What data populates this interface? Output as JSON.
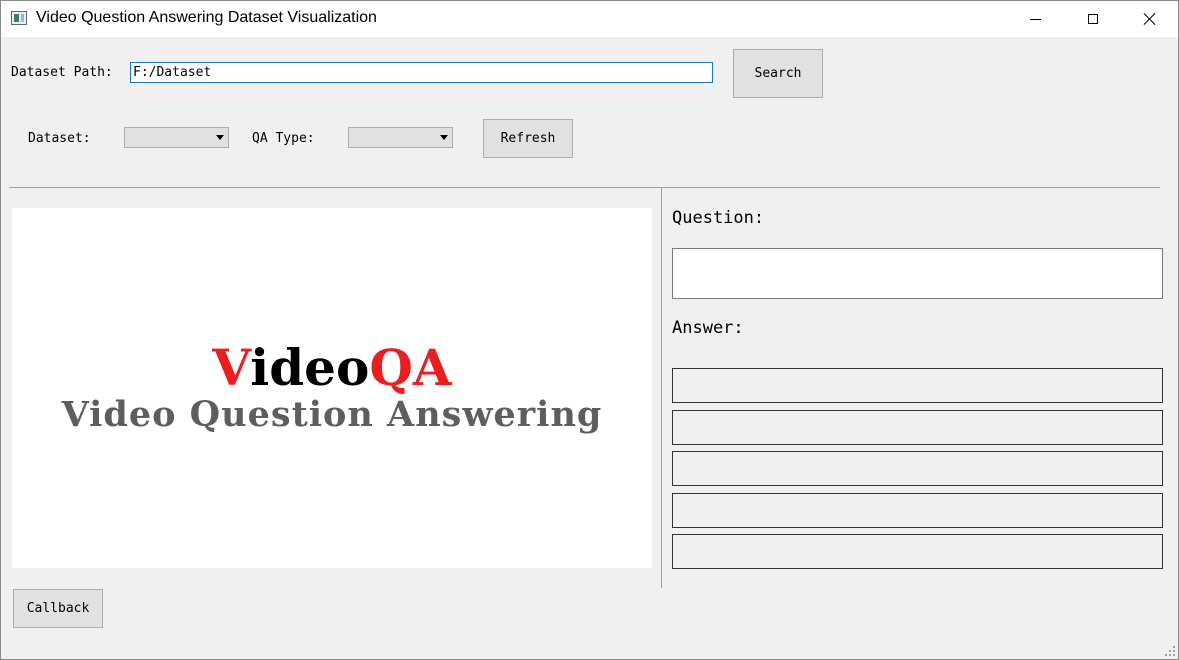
{
  "window": {
    "title": "Video Question Answering Dataset Visualization"
  },
  "toolbar": {
    "dataset_path_label": "Dataset Path:",
    "dataset_path_value": "F:/Dataset",
    "search_label": "Search",
    "dataset_label": "Dataset:",
    "dataset_selected": "",
    "qa_type_label": "QA Type:",
    "qa_type_selected": "",
    "refresh_label": "Refresh"
  },
  "preview": {
    "logo_title_first": "V",
    "logo_title_middle": "ideo",
    "logo_title_last": "QA",
    "logo_subtitle": "Video Question Answering"
  },
  "qa_panel": {
    "question_label": "Question:",
    "question_text": "",
    "answer_label": "Answer:",
    "answers": [
      "",
      "",
      "",
      "",
      ""
    ]
  },
  "footer": {
    "callback_label": "Callback"
  },
  "colors": {
    "accent_input_border": "#1b79b8",
    "logo_red": "#e81f1f",
    "logo_gray": "#5e5e5e"
  }
}
